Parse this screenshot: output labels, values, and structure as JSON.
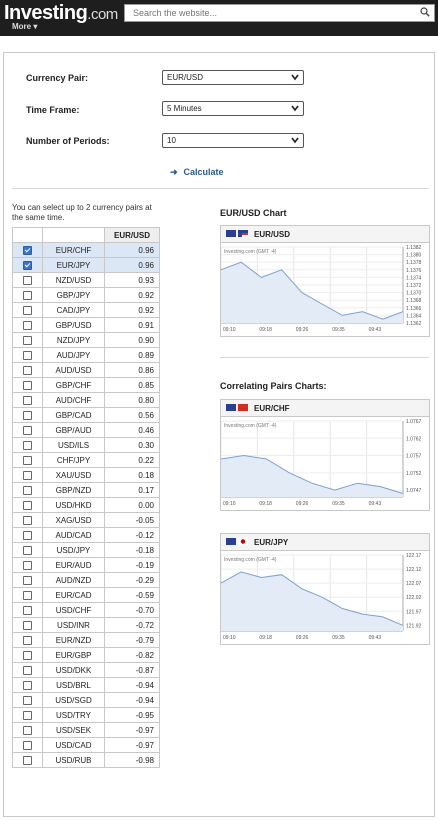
{
  "header": {
    "logo": "Investing",
    "logo_suffix": ".com",
    "more": "More ▾",
    "search_placeholder": "Search the website..."
  },
  "form": {
    "currency_pair_label": "Currency Pair:",
    "currency_pair_value": "EUR/USD",
    "time_frame_label": "Time Frame:",
    "time_frame_value": "5 Minutes",
    "periods_label": "Number of Periods:",
    "periods_value": "10",
    "calculate_label": "Calculate"
  },
  "note": "You can select up to 2 currency pairs at the same time.",
  "table": {
    "header_pair": "EUR/USD",
    "rows": [
      {
        "pair": "EUR/CHF",
        "value": "0.96",
        "checked": true
      },
      {
        "pair": "EUR/JPY",
        "value": "0.96",
        "checked": true
      },
      {
        "pair": "NZD/USD",
        "value": "0.93",
        "checked": false
      },
      {
        "pair": "GBP/JPY",
        "value": "0.92",
        "checked": false
      },
      {
        "pair": "CAD/JPY",
        "value": "0.92",
        "checked": false
      },
      {
        "pair": "GBP/USD",
        "value": "0.91",
        "checked": false
      },
      {
        "pair": "NZD/JPY",
        "value": "0.90",
        "checked": false
      },
      {
        "pair": "AUD/JPY",
        "value": "0.89",
        "checked": false
      },
      {
        "pair": "AUD/USD",
        "value": "0.86",
        "checked": false
      },
      {
        "pair": "GBP/CHF",
        "value": "0.85",
        "checked": false
      },
      {
        "pair": "AUD/CHF",
        "value": "0.80",
        "checked": false
      },
      {
        "pair": "GBP/CAD",
        "value": "0.56",
        "checked": false
      },
      {
        "pair": "GBP/AUD",
        "value": "0.46",
        "checked": false
      },
      {
        "pair": "USD/ILS",
        "value": "0.30",
        "checked": false
      },
      {
        "pair": "CHF/JPY",
        "value": "0.22",
        "checked": false
      },
      {
        "pair": "XAU/USD",
        "value": "0.18",
        "checked": false
      },
      {
        "pair": "GBP/NZD",
        "value": "0.17",
        "checked": false
      },
      {
        "pair": "USD/HKD",
        "value": "0.00",
        "checked": false
      },
      {
        "pair": "XAG/USD",
        "value": "-0.05",
        "checked": false
      },
      {
        "pair": "AUD/CAD",
        "value": "-0.12",
        "checked": false
      },
      {
        "pair": "USD/JPY",
        "value": "-0.18",
        "checked": false
      },
      {
        "pair": "EUR/AUD",
        "value": "-0.19",
        "checked": false
      },
      {
        "pair": "AUD/NZD",
        "value": "-0.29",
        "checked": false
      },
      {
        "pair": "EUR/CAD",
        "value": "-0.59",
        "checked": false
      },
      {
        "pair": "USD/CHF",
        "value": "-0.70",
        "checked": false
      },
      {
        "pair": "USD/INR",
        "value": "-0.72",
        "checked": false
      },
      {
        "pair": "EUR/NZD",
        "value": "-0.79",
        "checked": false
      },
      {
        "pair": "EUR/GBP",
        "value": "-0.82",
        "checked": false
      },
      {
        "pair": "USD/DKK",
        "value": "-0.87",
        "checked": false
      },
      {
        "pair": "USD/BRL",
        "value": "-0.94",
        "checked": false
      },
      {
        "pair": "USD/SGD",
        "value": "-0.94",
        "checked": false
      },
      {
        "pair": "USD/TRY",
        "value": "-0.95",
        "checked": false
      },
      {
        "pair": "USD/SEK",
        "value": "-0.97",
        "checked": false
      },
      {
        "pair": "USD/CAD",
        "value": "-0.97",
        "checked": false
      },
      {
        "pair": "USD/RUB",
        "value": "-0.98",
        "checked": false
      }
    ]
  },
  "main_chart_title": "EUR/USD Chart",
  "correlating_title": "Correlating Pairs Charts:",
  "colors": {
    "accent": "#2a5b8f",
    "selected_row": "#dce7f5",
    "line": "#7f9fcf",
    "fill": "#e3ebf7"
  },
  "chart_data": [
    {
      "type": "area",
      "name": "EUR/USD",
      "watermark": "Investing.com (GMT -4)",
      "x": [
        "09:10",
        "09:18",
        "09:26",
        "09:35",
        "09:43"
      ],
      "y_ticks": [
        "1.1382",
        "1.1380",
        "1.1378",
        "1.1376",
        "1.1374",
        "1.1372",
        "1.1370",
        "1.1368",
        "1.1366",
        "1.1364",
        "1.1362"
      ],
      "ylim": [
        1.1362,
        1.1382
      ],
      "values": [
        1.1376,
        1.1378,
        1.1374,
        1.1376,
        1.137,
        1.1367,
        1.1364,
        1.1365,
        1.1363,
        1.1365
      ]
    },
    {
      "type": "area",
      "name": "EUR/CHF",
      "watermark": "Investing.com (GMT -4)",
      "x": [
        "09:10",
        "09:18",
        "09:26",
        "09:35",
        "09:43"
      ],
      "y_ticks": [
        "1.0767",
        "1.0762",
        "1.0757",
        "1.0752",
        "1.0747"
      ],
      "ylim": [
        1.0745,
        1.0767
      ],
      "values": [
        1.0756,
        1.0757,
        1.0756,
        1.0752,
        1.0749,
        1.0747,
        1.0749,
        1.0748,
        1.0746
      ]
    },
    {
      "type": "area",
      "name": "EUR/JPY",
      "watermark": "Investing.com (GMT -4)",
      "x": [
        "09:10",
        "09:18",
        "09:26",
        "09:35",
        "09:43"
      ],
      "y_ticks": [
        "122.17",
        "122.12",
        "122.07",
        "122.02",
        "121.97",
        "121.92"
      ],
      "ylim": [
        121.9,
        122.17
      ],
      "values": [
        122.07,
        122.11,
        122.09,
        122.1,
        122.05,
        122.02,
        121.98,
        121.96,
        121.95,
        121.92
      ]
    }
  ]
}
